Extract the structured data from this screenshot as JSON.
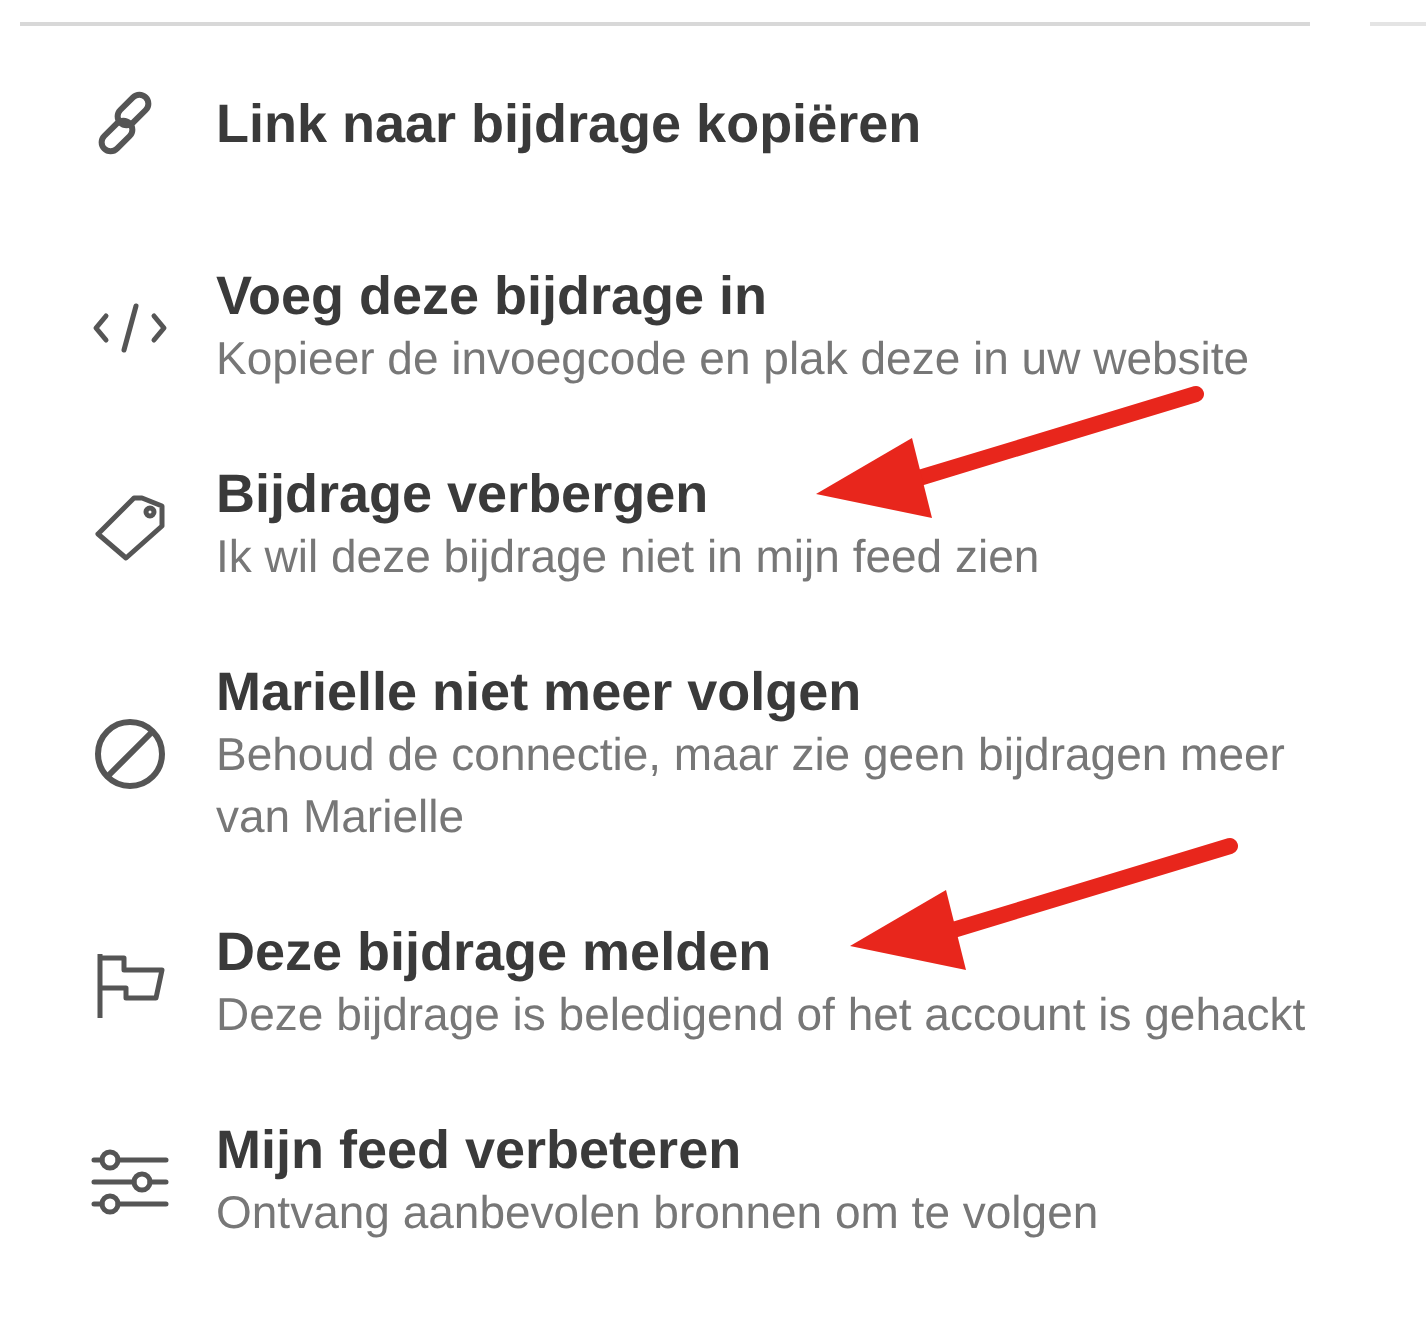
{
  "menu_items": [
    {
      "title": "Link naar bijdrage kopiëren",
      "arrow": false
    },
    {
      "title": "Voeg deze bijdrage in",
      "subtitle": "Kopieer de invoegcode en plak deze in uw website",
      "arrow": false
    },
    {
      "title": "Bijdrage verbergen",
      "subtitle": "Ik wil deze bijdrage niet in mijn feed zien",
      "arrow": true
    },
    {
      "title": "Marielle niet meer volgen",
      "subtitle": "Behoud de connectie, maar zie geen bijdragen meer van Marielle",
      "arrow": false
    },
    {
      "title": "Deze bijdrage melden",
      "subtitle": "Deze bijdrage is beledigend of het account is gehackt",
      "arrow": true
    },
    {
      "title": "Mijn feed verbeteren",
      "subtitle": "Ontvang aanbevolen bronnen om te volgen",
      "arrow": false
    }
  ]
}
